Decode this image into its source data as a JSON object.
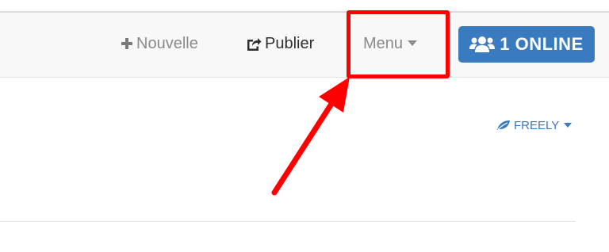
{
  "nav": {
    "new_label": "Nouvelle",
    "new_icon": "plus-icon",
    "publish_label": "Publier",
    "publish_icon": "share-icon",
    "menu_label": "Menu",
    "menu_icon": "caret-down-icon"
  },
  "online": {
    "label": "1 ONLINE",
    "icon": "users-icon",
    "color": "#3a7abf"
  },
  "freely": {
    "label": "FREELY",
    "icon": "leaf-icon",
    "caret": "caret-down-icon"
  },
  "annotation": {
    "color": "#ff0000"
  }
}
